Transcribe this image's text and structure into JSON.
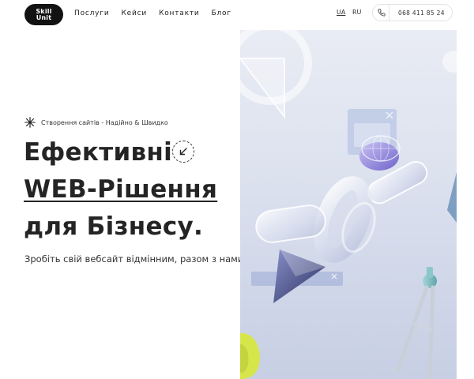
{
  "brand": {
    "logo_line1": "Skill",
    "logo_line2": "Unit"
  },
  "nav": {
    "items": [
      "Послуги",
      "Кейси",
      "Контакти",
      "Блог"
    ]
  },
  "languages": {
    "ua": "UA",
    "ru": "RU",
    "active": "UA"
  },
  "contact": {
    "phone": "068 411 85 24",
    "icon": "phone-icon"
  },
  "hero": {
    "tagline": "Створення сайтів - Надійно & Швидко",
    "title_line1": "Ефективні",
    "title_line2": "WEB-Рішення",
    "title_line3": "для Бізнесу.",
    "subtitle": "Зробіть свій вебсайт відмінним, разом з нами.",
    "arrow_icon": "arrow-down-left-icon",
    "image_alt": "3d-glass-shapes-illustration"
  },
  "colors": {
    "text": "#242424",
    "logo_bg": "#121212",
    "hero_bg": "#dde2ef",
    "accent_yellow": "#d6e64a",
    "accent_purple": "#7a6fd6"
  }
}
